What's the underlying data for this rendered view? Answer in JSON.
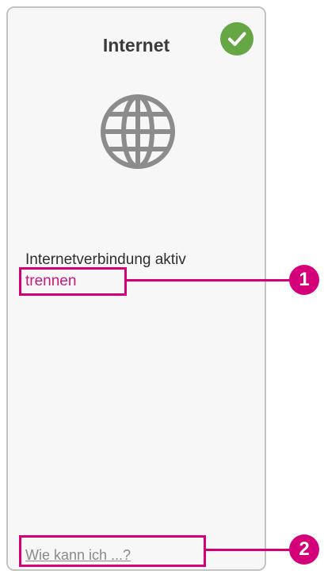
{
  "card": {
    "title": "Internet",
    "status_icon": "checkmark-icon",
    "illustration_icon": "globe-icon",
    "status_text": "Internetverbindung aktiv",
    "disconnect_link": "trennen",
    "help_link": "Wie kann ich ...?"
  },
  "callouts": [
    {
      "number": "1"
    },
    {
      "number": "2"
    }
  ],
  "colors": {
    "accent_magenta": "#d4007a",
    "link_magenta": "#c9177e",
    "status_green": "#67a644",
    "card_border": "#c4c4c4",
    "card_background": "#f7f7f8"
  }
}
